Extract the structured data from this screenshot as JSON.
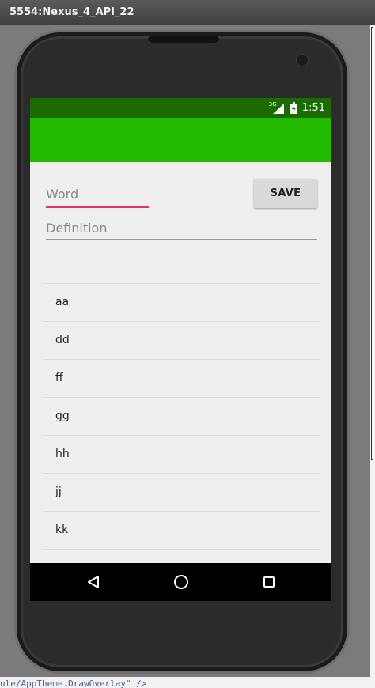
{
  "window": {
    "title": "5554:Nexus_4_API_22"
  },
  "status_bar": {
    "network_label": "3G",
    "time": "1:51"
  },
  "form": {
    "word_placeholder": "Word",
    "definition_placeholder": "Definition",
    "save_label": "SAVE"
  },
  "word_list": {
    "items": [
      "aa",
      "dd",
      "ff",
      "gg",
      "hh",
      "jj",
      "kk"
    ]
  },
  "background_editor": {
    "visible_code": "ule/AppTheme.DrawOverlay\" />"
  },
  "icons": {
    "signal": "signal-icon",
    "battery": "battery-charging-icon",
    "back": "back-triangle-icon",
    "home": "home-circle-icon",
    "recent": "recent-apps-icon"
  },
  "colors": {
    "status_bar": "#1b6b02",
    "app_bar": "#22bb00",
    "accent": "#e4306f",
    "background": "#efefef"
  }
}
